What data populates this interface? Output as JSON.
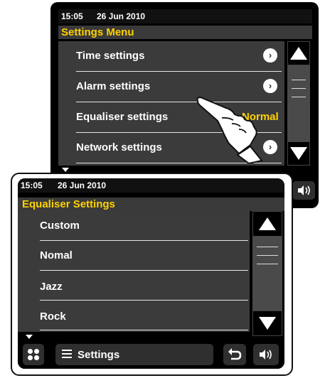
{
  "top_screen": {
    "time": "15:05",
    "date": "26 Jun 2010",
    "title": "Settings Menu",
    "items": [
      {
        "label": "Time settings",
        "chevron": "›"
      },
      {
        "label": "Alarm settings",
        "chevron": "›"
      },
      {
        "label": "Equaliser settings",
        "value": "Normal"
      },
      {
        "label": "Network settings",
        "chevron": "›"
      }
    ]
  },
  "bottom_screen": {
    "time": "15:05",
    "date": "26 Jun 2010",
    "title": "Equaliser Settings",
    "items": [
      {
        "label": "Custom"
      },
      {
        "label": "Nomal"
      },
      {
        "label": "Jazz"
      },
      {
        "label": "Rock"
      }
    ],
    "bar": {
      "settings_label": "Settings"
    }
  },
  "colors": {
    "accent": "#ffd200",
    "panel": "#3b3b3b",
    "status_bg": "#111111"
  },
  "icons": [
    "scroll-up-icon",
    "scroll-down-icon",
    "speaker-icon",
    "chevron-right-icon",
    "home-dots-icon",
    "menu-list-icon",
    "back-arrow-icon",
    "pointing-hand-icon"
  ]
}
